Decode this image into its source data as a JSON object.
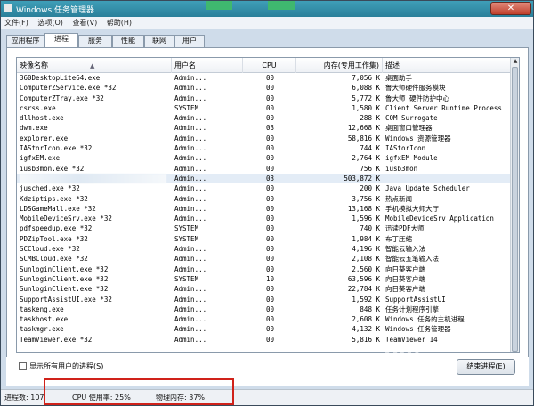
{
  "window": {
    "title": "Windows 任务管理器",
    "close_label": "✕"
  },
  "menu": [
    "文件(F)",
    "选项(O)",
    "查看(V)",
    "帮助(H)"
  ],
  "tabs": [
    "应用程序",
    "进程",
    "服务",
    "性能",
    "联网",
    "用户"
  ],
  "active_tab": "进程",
  "columns": {
    "name": "映像名称",
    "user": "用户名",
    "cpu": "CPU",
    "mem": "内存(专用工作集)",
    "desc": "描述"
  },
  "processes": [
    {
      "name": "360DesktopLite64.exe",
      "user": "Admin...",
      "cpu": "00",
      "mem": "7,056 K",
      "desc": "桌面助手"
    },
    {
      "name": "ComputerZService.exe *32",
      "user": "Admin...",
      "cpu": "00",
      "mem": "6,088 K",
      "desc": "鲁大师硬件服务模块"
    },
    {
      "name": "ComputerZTray.exe *32",
      "user": "Admin...",
      "cpu": "00",
      "mem": "5,772 K",
      "desc": "鲁大师 硬件防护中心"
    },
    {
      "name": "csrss.exe",
      "user": "SYSTEM",
      "cpu": "00",
      "mem": "1,580 K",
      "desc": "Client Server Runtime Process"
    },
    {
      "name": "dllhost.exe",
      "user": "Admin...",
      "cpu": "00",
      "mem": "288 K",
      "desc": "COM Surrogate"
    },
    {
      "name": "dwm.exe",
      "user": "Admin...",
      "cpu": "03",
      "mem": "12,668 K",
      "desc": "桌面窗口管理器"
    },
    {
      "name": "explorer.exe",
      "user": "Admin...",
      "cpu": "00",
      "mem": "58,816 K",
      "desc": "Windows 资源管理器"
    },
    {
      "name": "IAStorIcon.exe *32",
      "user": "Admin...",
      "cpu": "00",
      "mem": "744 K",
      "desc": "IAStorIcon"
    },
    {
      "name": "igfxEM.exe",
      "user": "Admin...",
      "cpu": "00",
      "mem": "2,764 K",
      "desc": "igfxEM Module"
    },
    {
      "name": "iusb3mon.exe *32",
      "user": "Admin...",
      "cpu": "00",
      "mem": "756 K",
      "desc": "iusb3mon"
    },
    {
      "name": "",
      "user": "Admin...",
      "cpu": "03",
      "mem": "503,872 K",
      "desc": "",
      "selected": true
    },
    {
      "name": "jusched.exe *32",
      "user": "Admin...",
      "cpu": "00",
      "mem": "200 K",
      "desc": "Java Update Scheduler"
    },
    {
      "name": "Kdziptips.exe *32",
      "user": "Admin...",
      "cpu": "00",
      "mem": "3,756 K",
      "desc": "热点新闻"
    },
    {
      "name": "LDSGameMall.exe *32",
      "user": "Admin...",
      "cpu": "00",
      "mem": "13,168 K",
      "desc": "手机模拟大师大厅"
    },
    {
      "name": "MobileDeviceSrv.exe *32",
      "user": "Admin...",
      "cpu": "00",
      "mem": "1,596 K",
      "desc": "MobileDeviceSrv Application"
    },
    {
      "name": "pdfspeedup.exe *32",
      "user": "SYSTEM",
      "cpu": "00",
      "mem": "740 K",
      "desc": "迅读PDF大师"
    },
    {
      "name": "PDZipTool.exe *32",
      "user": "SYSTEM",
      "cpu": "00",
      "mem": "1,984 K",
      "desc": "布丁压缩"
    },
    {
      "name": "SCCloud.exe *32",
      "user": "Admin...",
      "cpu": "00",
      "mem": "4,196 K",
      "desc": "智能云输入法"
    },
    {
      "name": "SCMBCloud.exe *32",
      "user": "Admin...",
      "cpu": "00",
      "mem": "2,108 K",
      "desc": "智能云五笔输入法"
    },
    {
      "name": "SunloginClient.exe *32",
      "user": "Admin...",
      "cpu": "00",
      "mem": "2,560 K",
      "desc": "向日葵客户端"
    },
    {
      "name": "SunloginClient.exe *32",
      "user": "SYSTEM",
      "cpu": "10",
      "mem": "63,596 K",
      "desc": "向日葵客户端"
    },
    {
      "name": "SunloginClient.exe *32",
      "user": "Admin...",
      "cpu": "00",
      "mem": "22,784 K",
      "desc": "向日葵客户端"
    },
    {
      "name": "SupportAssistUI.exe *32",
      "user": "Admin...",
      "cpu": "00",
      "mem": "1,592 K",
      "desc": "SupportAssistUI"
    },
    {
      "name": "taskeng.exe",
      "user": "Admin...",
      "cpu": "00",
      "mem": "848 K",
      "desc": "任务计划程序引擎"
    },
    {
      "name": "taskhost.exe",
      "user": "Admin...",
      "cpu": "00",
      "mem": "2,608 K",
      "desc": "Windows 任务的主机进程"
    },
    {
      "name": "taskmgr.exe",
      "user": "Admin...",
      "cpu": "00",
      "mem": "4,132 K",
      "desc": "Windows 任务管理器"
    },
    {
      "name": "TeamViewer.exe *32",
      "user": "Admin...",
      "cpu": "00",
      "mem": "5,816 K",
      "desc": "TeamViewer 14"
    }
  ],
  "show_all_label": "显示所有用户的进程(S)",
  "end_process_label": "结束进程(E)",
  "status": {
    "process_count": "进程数: 107",
    "cpu_usage": "CPU 使用率: 25%",
    "memory": "物理内存: 37%"
  },
  "watermark": "Bai"
}
